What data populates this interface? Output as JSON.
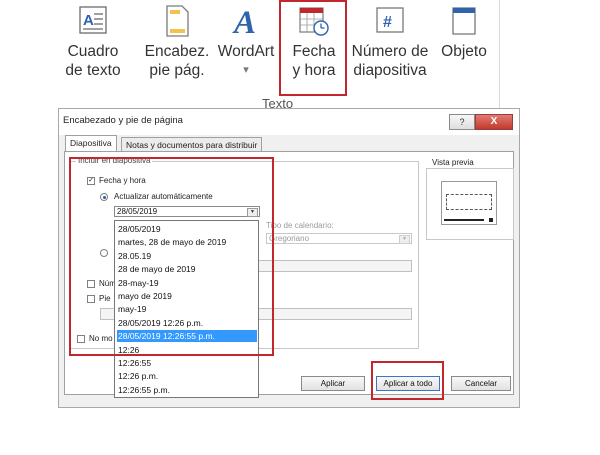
{
  "ribbon": {
    "buttons": [
      {
        "line1": "Cuadro",
        "line2": "de texto",
        "icon": "text-box-icon"
      },
      {
        "line1": "Encabez.",
        "line2": "pie pág.",
        "icon": "header-footer-icon"
      },
      {
        "line1": "WordArt",
        "line2": "▾",
        "icon": "wordart-icon"
      },
      {
        "line1": "Fecha",
        "line2": "y hora",
        "icon": "date-time-icon"
      },
      {
        "line1": "Número de",
        "line2": "diapositiva",
        "icon": "slide-number-icon"
      },
      {
        "line1": "Objeto",
        "line2": "",
        "icon": "object-icon"
      }
    ],
    "group_label": "Texto"
  },
  "dialog": {
    "title": "Encabezado y pie de página",
    "help": "?",
    "close": "X",
    "tabs": [
      "Diapositiva",
      "Notas y documentos para distribuir"
    ],
    "include_group": "Incluir en diapositiva",
    "date_time_label": "Fecha y hora",
    "auto_update_label": "Actualizar automáticamente",
    "selected_date": "28/05/2019",
    "calendar_label": "Tipo de calendario:",
    "calendar_value": "Gregoriano",
    "slide_number_label": "Núm",
    "footer_label": "Pie",
    "no_title_label": "No mo",
    "preview_label": "Vista previa",
    "dropdown_items": [
      "28/05/2019",
      "martes, 28 de mayo de 2019",
      "28.05.19",
      "28 de mayo de 2019",
      "28-may-19",
      "mayo de 2019",
      "may-19",
      "28/05/2019 12:26 p.m.",
      "28/05/2019 12:26:55 p.m.",
      "12:26",
      "12:26:55",
      "12:26 p.m.",
      "12:26:55 p.m."
    ],
    "selected_index": 8,
    "buttons": {
      "apply": "Aplicar",
      "apply_all": "Aplicar a todo",
      "cancel": "Cancelar"
    }
  },
  "colors": {
    "highlight": "#c0282d",
    "selection": "#3399ff",
    "accent_icon": "#2e63ad"
  }
}
